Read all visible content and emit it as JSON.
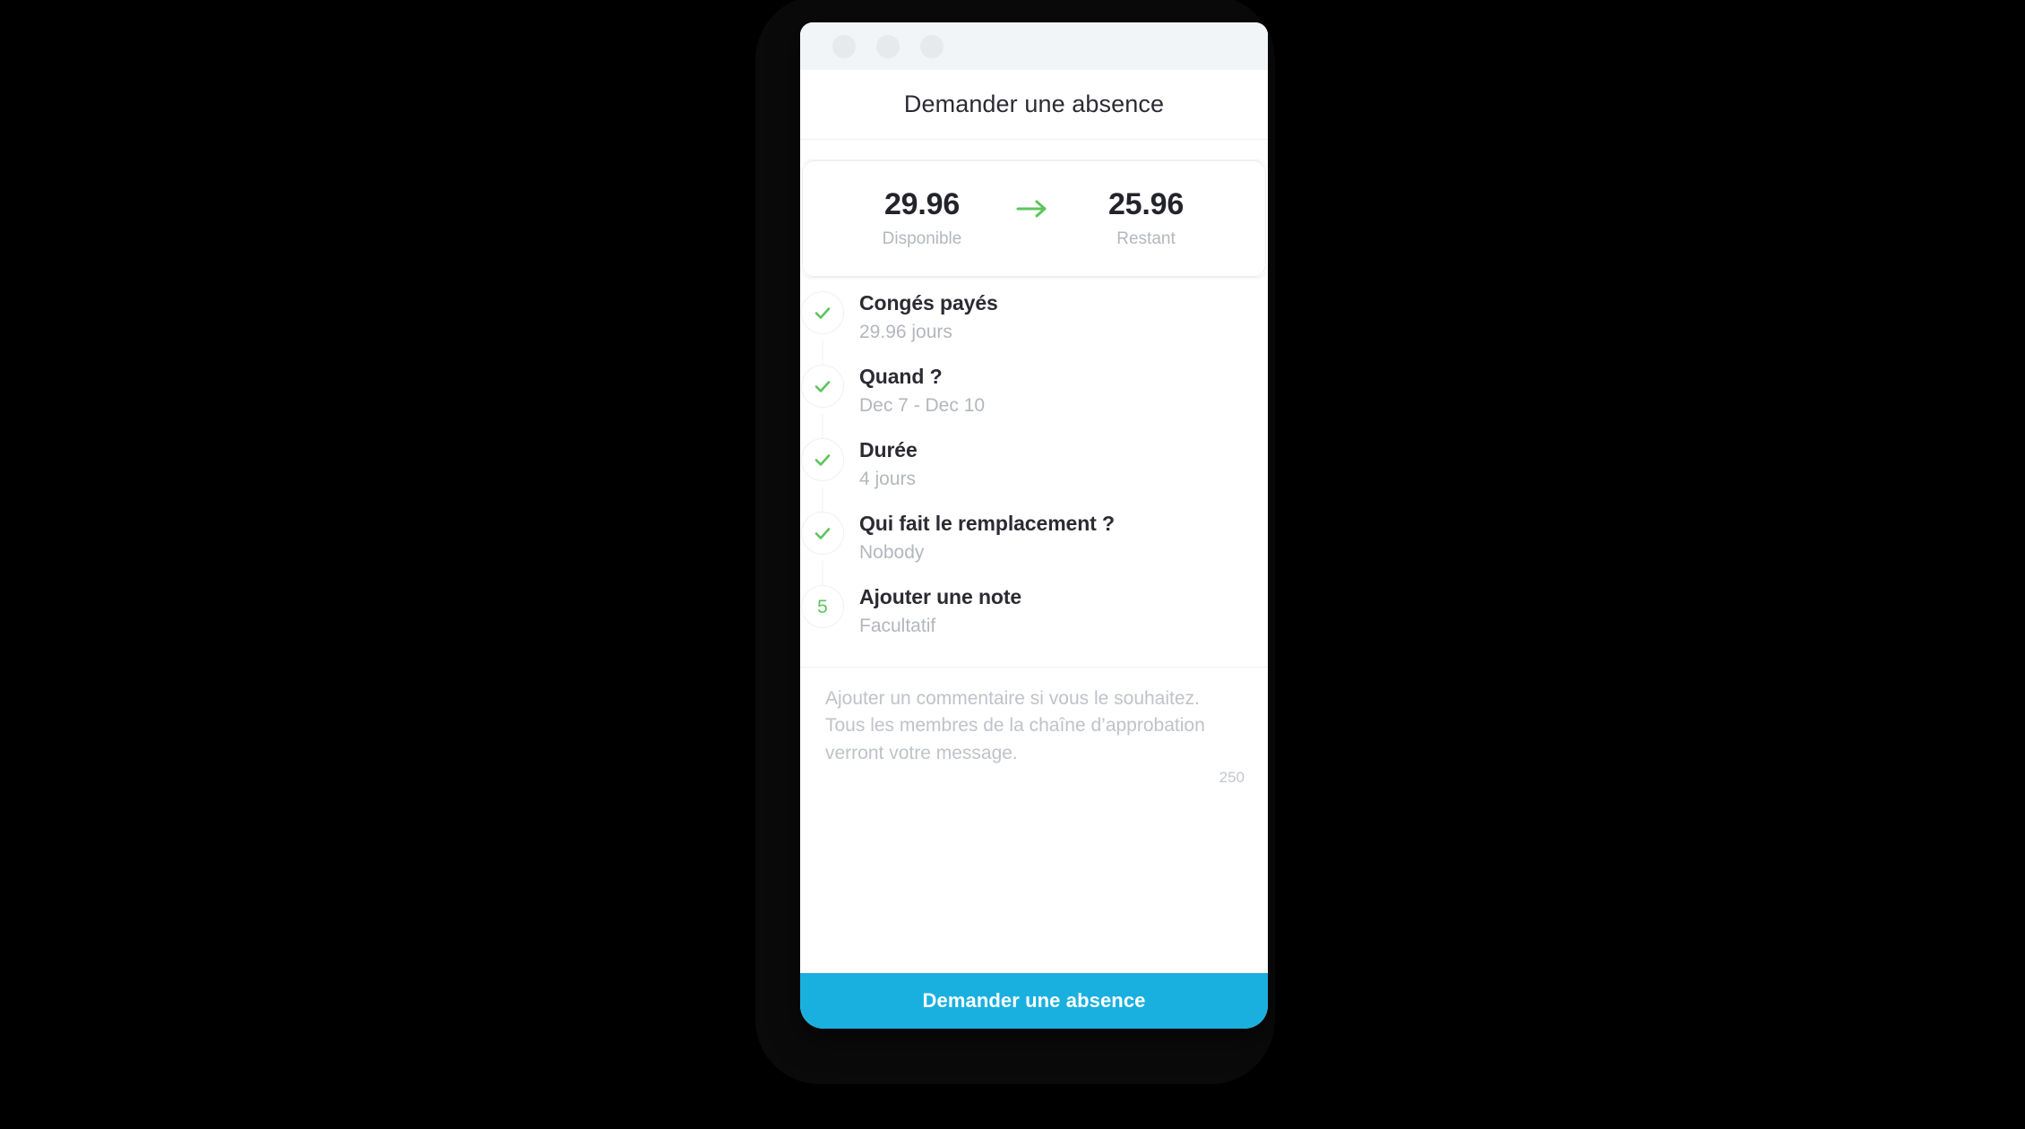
{
  "window": {
    "chrome_dots": [
      "dot-1",
      "dot-2",
      "dot-3"
    ],
    "title": "Demander une absence"
  },
  "balance": {
    "available_value": "29.96",
    "available_label": "Disponible",
    "arrow_icon": "arrow-right-icon",
    "remaining_value": "25.96",
    "remaining_label": "Restant"
  },
  "steps": [
    {
      "marker": "check-icon",
      "state": "complete",
      "title": "Congés payés",
      "subtitle": "29.96 jours"
    },
    {
      "marker": "check-icon",
      "state": "complete",
      "title": "Quand ?",
      "subtitle": "Dec 7 - Dec 10"
    },
    {
      "marker": "check-icon",
      "state": "complete",
      "title": "Durée",
      "subtitle": "4 jours"
    },
    {
      "marker": "check-icon",
      "state": "complete",
      "title": "Qui fait le remplacement ?",
      "subtitle": "Nobody"
    },
    {
      "marker": "5",
      "state": "current",
      "title": "Ajouter une note",
      "subtitle": "Facultatif"
    }
  ],
  "note": {
    "value": "",
    "placeholder": "Ajouter un commentaire si vous le souhaitez. Tous les membres de la chaîne d’approbation verront votre message.",
    "counter": "250"
  },
  "cta": {
    "label": "Demander une absence"
  },
  "colors": {
    "accent": "#19b0e0",
    "success": "#5ec45e",
    "chrome_bar": "#f2f5f8",
    "dot": "#e7eaed",
    "muted_text": "#b3b7bd",
    "title_text": "#2b2b33"
  }
}
